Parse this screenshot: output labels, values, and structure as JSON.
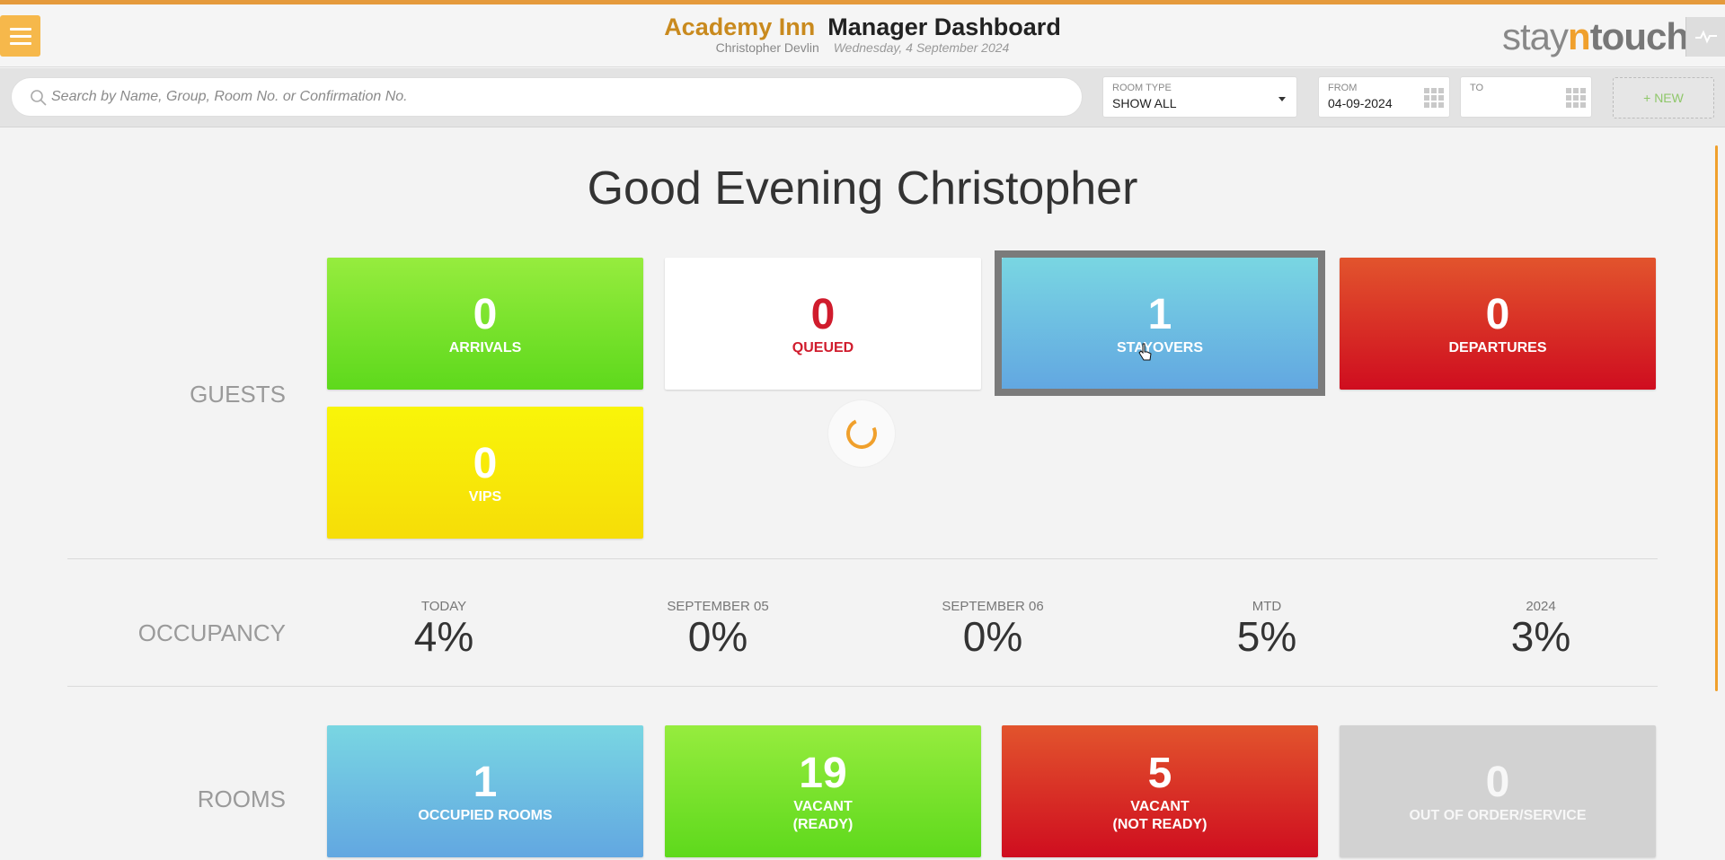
{
  "header": {
    "hotel_name": "Academy Inn",
    "dashboard_title": "Manager Dashboard",
    "user_name": "Christopher Devlin",
    "date": "Wednesday, 4 September 2024",
    "brand_stay": "stay",
    "brand_n": "n",
    "brand_touch": "touch"
  },
  "search": {
    "placeholder": "Search by Name, Group, Room No. or Confirmation No."
  },
  "filters": {
    "room_type_label": "ROOM TYPE",
    "room_type_value": "SHOW ALL",
    "from_label": "FROM",
    "from_value": "04-09-2024",
    "to_label": "TO",
    "to_value": "",
    "new_button": "+ NEW"
  },
  "greeting": "Good Evening Christopher",
  "guests": {
    "section_label": "GUESTS",
    "tiles": [
      {
        "value": "0",
        "label": "ARRIVALS"
      },
      {
        "value": "0",
        "label": "QUEUED"
      },
      {
        "value": "1",
        "label": "STAYOVERS"
      },
      {
        "value": "0",
        "label": "DEPARTURES"
      },
      {
        "value": "0",
        "label": "VIPS"
      }
    ]
  },
  "occupancy": {
    "section_label": "OCCUPANCY",
    "items": [
      {
        "period": "TODAY",
        "value": "4%"
      },
      {
        "period": "SEPTEMBER 05",
        "value": "0%"
      },
      {
        "period": "SEPTEMBER 06",
        "value": "0%"
      },
      {
        "period": "MTD",
        "value": "5%"
      },
      {
        "period": "2024",
        "value": "3%"
      }
    ]
  },
  "rooms": {
    "section_label": "ROOMS",
    "tiles": [
      {
        "value": "1",
        "label_line1": "OCCUPIED ROOMS",
        "label_line2": ""
      },
      {
        "value": "19",
        "label_line1": "VACANT",
        "label_line2": "(READY)"
      },
      {
        "value": "5",
        "label_line1": "VACANT",
        "label_line2": "(NOT READY)"
      },
      {
        "value": "0",
        "label_line1": "OUT OF ORDER/SERVICE",
        "label_line2": ""
      }
    ]
  },
  "colors": {
    "accent": "#e59a3c",
    "arrivals": "#5ed91c",
    "queued_text": "#d01c2d",
    "stayovers": "#62a7e1",
    "departures": "#cf0d1f",
    "vips": "#f6dd08",
    "out_of_order": "#d2d2d2"
  }
}
